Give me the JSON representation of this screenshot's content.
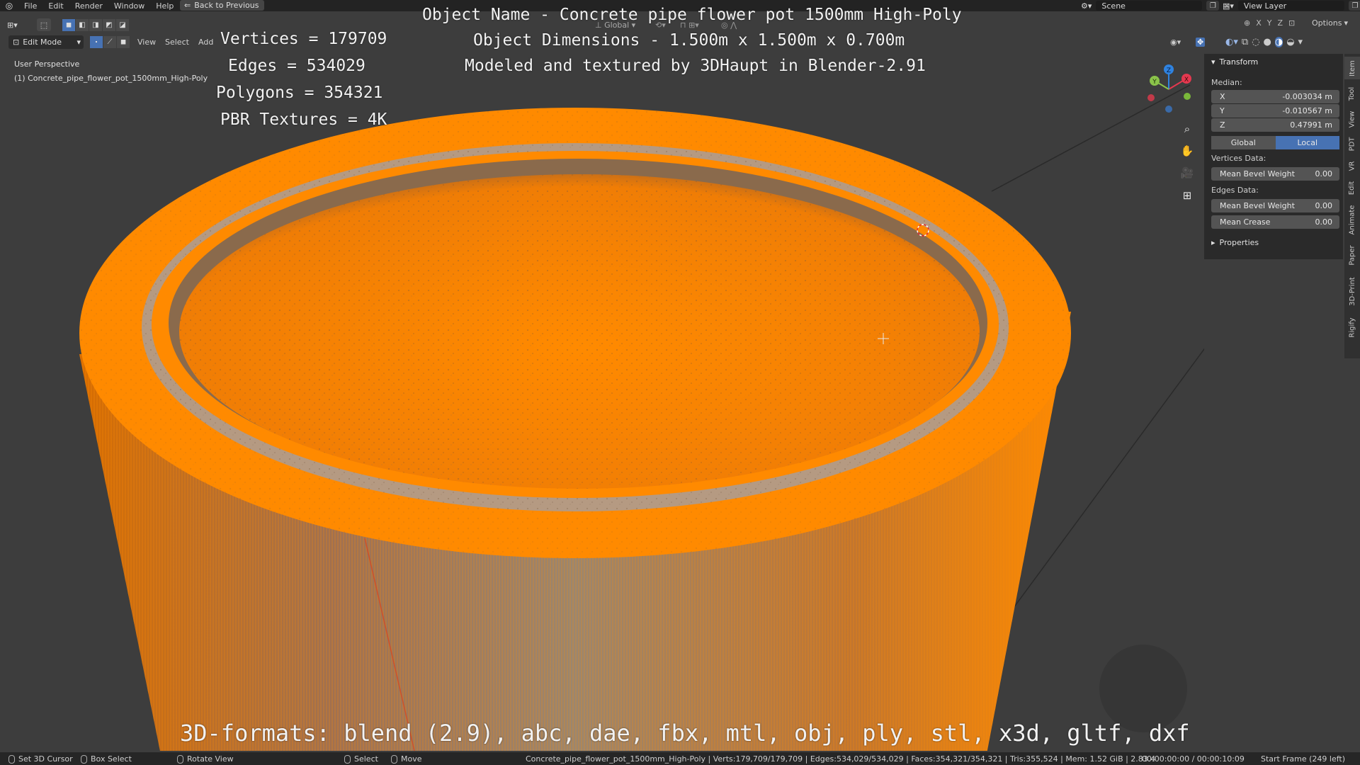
{
  "topbar": {
    "menus": [
      "File",
      "Edit",
      "Render",
      "Window",
      "Help"
    ],
    "back_button": "Back to Previous",
    "scene": "Scene",
    "view_layer": "View Layer"
  },
  "toolheader": {
    "orientation": "Global",
    "axes": [
      "X",
      "Y",
      "Z"
    ],
    "options": "Options"
  },
  "header2": {
    "mode": "Edit Mode",
    "menus": [
      "View",
      "Select",
      "Add"
    ]
  },
  "viewport": {
    "perspective": "User Perspective",
    "object_label": "(1) Concrete_pipe_flower_pot_1500mm_High-Poly"
  },
  "overlay": {
    "stats": [
      "Vertices = 179709",
      "Edges = 534029",
      "Polygons = 354321",
      "PBR Textures = 4K"
    ],
    "info": [
      "Object Name - Concrete pipe flower pot 1500mm High-Poly",
      "Object Dimensions -  1.500m x 1.500m x 0.700m",
      "Modeled and textured by 3DHaupt in Blender-2.91"
    ],
    "formats": "3D-formats: blend (2.9), abc, dae, fbx, mtl, obj, ply, stl, x3d, gltf, dxf"
  },
  "gizmo": {
    "axes": [
      "X",
      "Y",
      "Z"
    ]
  },
  "npanel": {
    "transform_title": "Transform",
    "median_label": "Median:",
    "x_label": "X",
    "x_value": "-0.003034 m",
    "y_label": "Y",
    "y_value": "-0.010567 m",
    "z_label": "Z",
    "z_value": "0.47991 m",
    "global": "Global",
    "local": "Local",
    "vertices_data": "Vertices Data:",
    "mean_bevel_weight": "Mean Bevel Weight",
    "vert_bevel_value": "0.00",
    "edges_data": "Edges Data:",
    "edge_bevel_value": "0.00",
    "mean_crease": "Mean Crease",
    "crease_value": "0.00",
    "properties": "Properties"
  },
  "tabs": [
    "Item",
    "Tool",
    "View",
    "PDT",
    "VR",
    "Edit",
    "Animate",
    "Paper",
    "3D-Print",
    "Rigify"
  ],
  "statusbar": {
    "set_cursor": "Set 3D Cursor",
    "box_select": "Box Select",
    "rotate_view": "Rotate View",
    "select": "Select",
    "move": "Move",
    "stats": "Concrete_pipe_flower_pot_1500mm_High-Poly | Verts:179,709/179,709 | Edges:534,029/534,029 | Faces:354,321/354,321 | Tris:355,524 | Mem: 1.52 GiB | 2.83.4",
    "time": "00:00:00:00 / 00:00:10:09",
    "start_frame": "Start Frame (249 left)"
  },
  "colors": {
    "selection_orange": "#ff8a00",
    "active_blue": "#4772b3",
    "axis_x": "#e5384f",
    "axis_y": "#8bc34a",
    "axis_z": "#2f83e0"
  }
}
